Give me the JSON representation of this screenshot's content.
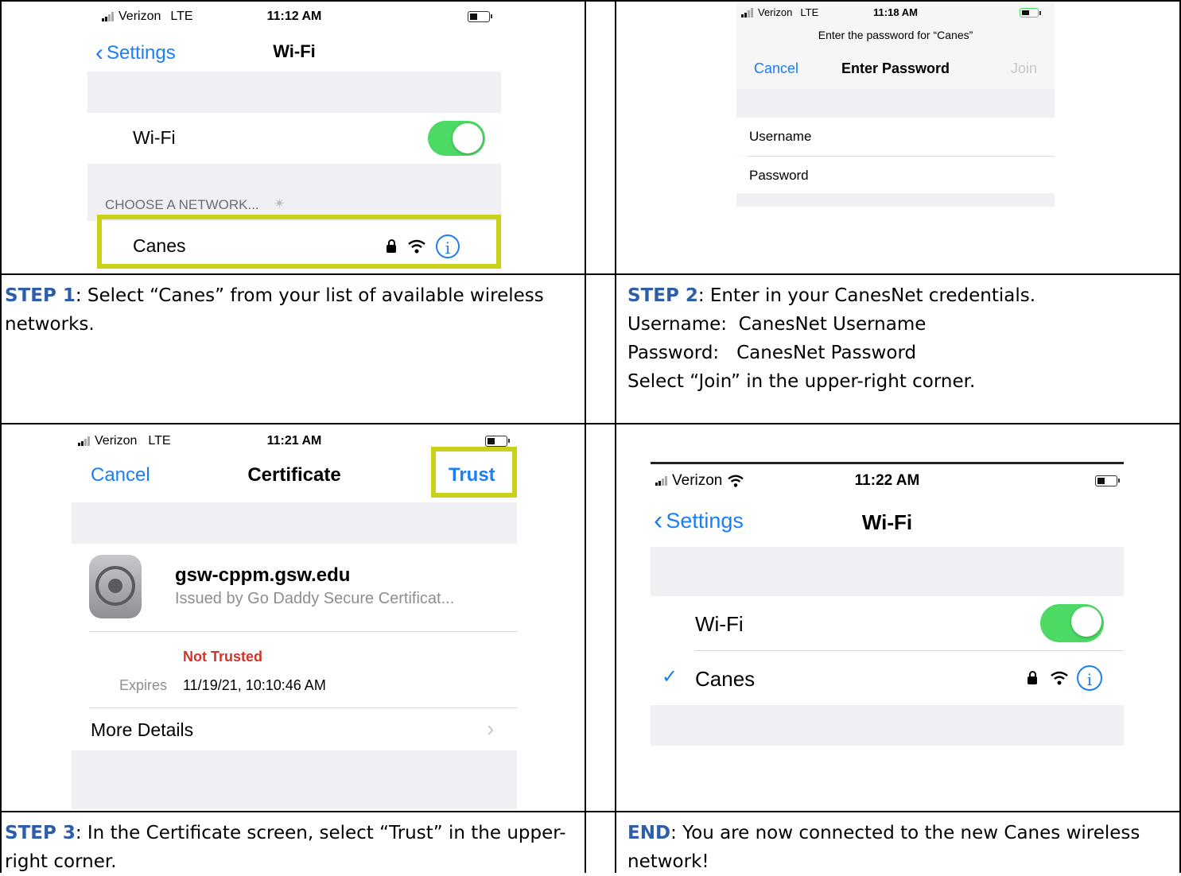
{
  "step1": {
    "screen": {
      "carrier": "Verizon",
      "network_type": "LTE",
      "time": "11:12 AM",
      "back_label": "Settings",
      "title": "Wi-Fi",
      "wifi_label": "Wi-Fi",
      "wifi_on": true,
      "section_header": "CHOOSE A NETWORK...",
      "network_name": "Canes"
    },
    "caption_step": "STEP 1",
    "caption_text": ": Select “Canes” from your list of available wireless networks."
  },
  "step2": {
    "screen": {
      "carrier": "Verizon",
      "network_type": "LTE",
      "time": "11:18 AM",
      "prompt": "Enter the password for “Canes”",
      "cancel_label": "Cancel",
      "title": "Enter Password",
      "join_label": "Join",
      "username_label": "Username",
      "password_label": "Password"
    },
    "caption_step": "STEP 2",
    "caption_text": ": Enter in your CanesNet credentials.",
    "caption_lines": [
      "Username:  CanesNet Username",
      "Password:   CanesNet Password",
      "Select “Join” in the upper-right corner."
    ]
  },
  "step3": {
    "screen": {
      "carrier": "Verizon",
      "network_type": "LTE",
      "time": "11:21 AM",
      "cancel_label": "Cancel",
      "title": "Certificate",
      "trust_label": "Trust",
      "cert_name": "gsw-cppm.gsw.edu",
      "cert_issuer": "Issued by Go Daddy Secure Certificat...",
      "trust_status": "Not Trusted",
      "expires_label": "Expires",
      "expires_value": "11/19/21, 10:10:46 AM",
      "more_details_label": "More Details"
    },
    "caption_step": "STEP 3",
    "caption_text": ": In the Certificate screen, select “Trust” in the upper-right corner."
  },
  "end": {
    "screen": {
      "carrier": "Verizon",
      "time": "11:22 AM",
      "back_label": "Settings",
      "title": "Wi-Fi",
      "wifi_label": "Wi-Fi",
      "wifi_on": true,
      "network_name": "Canes",
      "connected": true
    },
    "caption_step": "END",
    "caption_text": ": You are now connected to the new Canes wireless network!"
  },
  "colors": {
    "step_label": "#2e5ea8",
    "highlight": "#c9d11a",
    "ios_blue": "#1a7ef5",
    "toggle_green": "#4cd964",
    "not_trusted_red": "#d0342c"
  }
}
